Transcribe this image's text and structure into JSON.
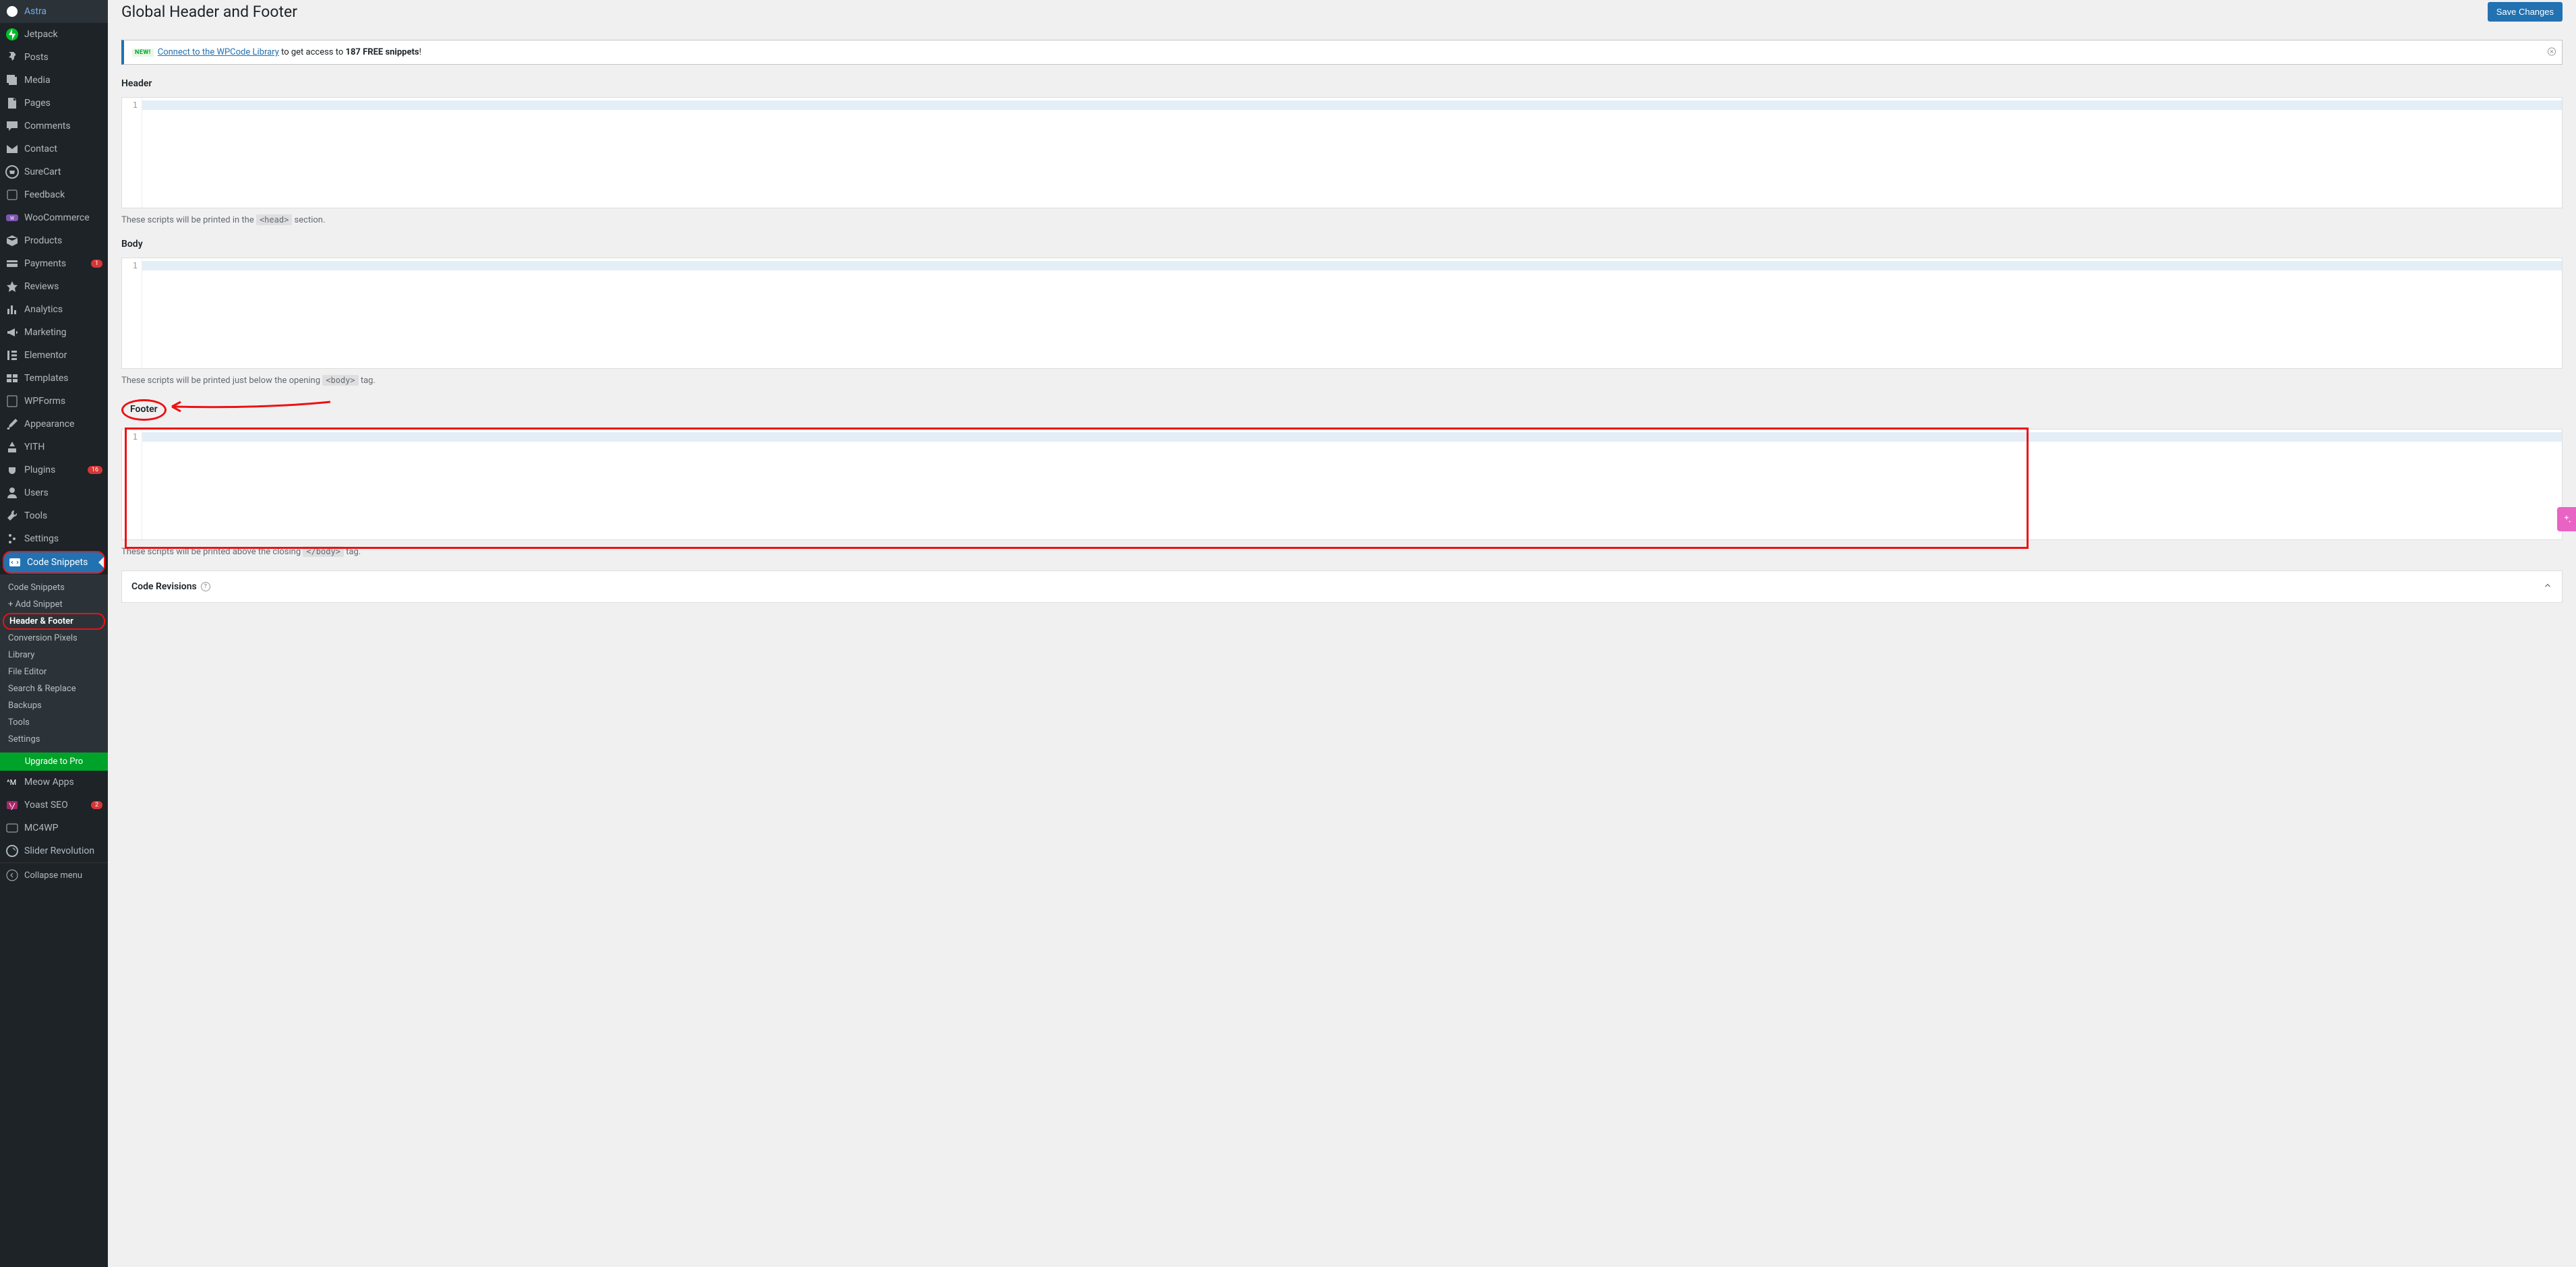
{
  "page": {
    "title": "Global Header and Footer",
    "save_button": "Save Changes"
  },
  "notice": {
    "badge": "NEW!",
    "link": "Connect to the WPCode Library",
    "text_before": " to get access to ",
    "bold": "187 FREE snippets",
    "text_after": "!"
  },
  "sections": {
    "header": {
      "title": "Header",
      "gutter": "1",
      "desc_before": "These scripts will be printed in the ",
      "tag": "<head>",
      "desc_after": " section."
    },
    "body": {
      "title": "Body",
      "gutter": "1",
      "desc_before": "These scripts will be printed just below the opening ",
      "tag": "<body>",
      "desc_after": " tag."
    },
    "footer": {
      "title": "Footer",
      "gutter": "1",
      "desc_before": "These scripts will be printed above the closing ",
      "tag": "</body>",
      "desc_after": " tag."
    }
  },
  "revisions": {
    "title": "Code Revisions"
  },
  "sidebar": {
    "items": [
      {
        "label": "Astra",
        "icon": "logo"
      },
      {
        "label": "Jetpack",
        "icon": "jetpack"
      },
      {
        "label": "Posts",
        "icon": "pin"
      },
      {
        "label": "Media",
        "icon": "media"
      },
      {
        "label": "Pages",
        "icon": "page"
      },
      {
        "label": "Comments",
        "icon": "comment"
      },
      {
        "label": "Contact",
        "icon": "mail"
      },
      {
        "label": "SureCart",
        "icon": "cart-circle"
      },
      {
        "label": "Feedback",
        "icon": "feedback"
      },
      {
        "label": "WooCommerce",
        "icon": "woo"
      },
      {
        "label": "Products",
        "icon": "box"
      },
      {
        "label": "Payments",
        "icon": "card",
        "badge": "1",
        "badge_color": "red"
      },
      {
        "label": "Reviews",
        "icon": "star"
      },
      {
        "label": "Analytics",
        "icon": "chart"
      },
      {
        "label": "Marketing",
        "icon": "megaphone"
      },
      {
        "label": "Elementor",
        "icon": "elementor"
      },
      {
        "label": "Templates",
        "icon": "templates"
      },
      {
        "label": "WPForms",
        "icon": "wpforms"
      },
      {
        "label": "Appearance",
        "icon": "brush"
      },
      {
        "label": "YITH",
        "icon": "yith"
      },
      {
        "label": "Plugins",
        "icon": "plugin",
        "badge": "16",
        "badge_color": "red"
      },
      {
        "label": "Users",
        "icon": "user"
      },
      {
        "label": "Tools",
        "icon": "wrench"
      },
      {
        "label": "Settings",
        "icon": "sliders"
      },
      {
        "label": "Code Snippets",
        "icon": "code",
        "active": true
      }
    ],
    "submenu": [
      {
        "label": "Code Snippets"
      },
      {
        "label": "+ Add Snippet"
      },
      {
        "label": "Header & Footer",
        "active": true,
        "annotated": true
      },
      {
        "label": "Conversion Pixels"
      },
      {
        "label": "Library"
      },
      {
        "label": "File Editor"
      },
      {
        "label": "Search & Replace"
      },
      {
        "label": "Backups"
      },
      {
        "label": "Tools"
      },
      {
        "label": "Settings"
      }
    ],
    "upgrade": "Upgrade to Pro",
    "items_after": [
      {
        "label": "Meow Apps",
        "icon": "meow"
      },
      {
        "label": "Yoast SEO",
        "icon": "yoast",
        "badge": "2",
        "badge_color": "red"
      },
      {
        "label": "MC4WP",
        "icon": "mc4wp"
      },
      {
        "label": "Slider Revolution",
        "icon": "slider"
      }
    ],
    "collapse": "Collapse menu"
  }
}
